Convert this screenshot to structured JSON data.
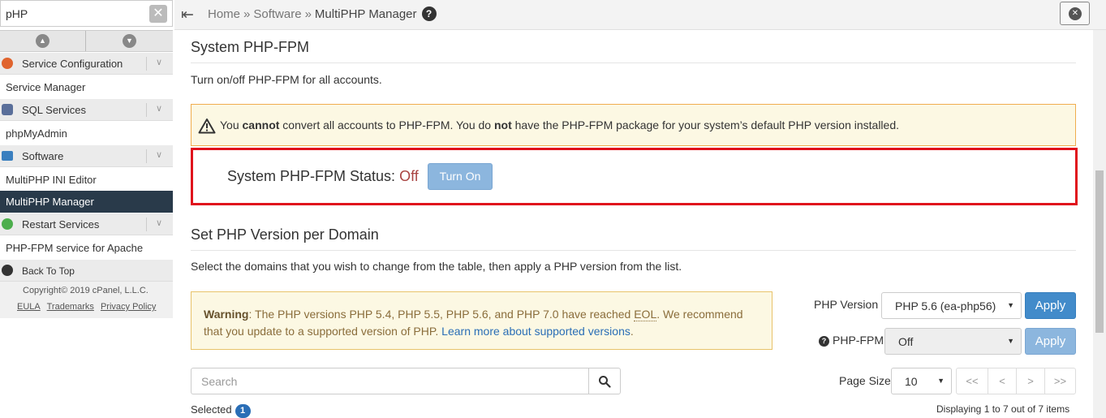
{
  "sidebar": {
    "search_value": "pHP",
    "groups": [
      {
        "label": "Service Configuration",
        "item": "Service Manager"
      },
      {
        "label": "SQL Services",
        "item": "phpMyAdmin"
      },
      {
        "label": "Software",
        "items": [
          "MultiPHP INI Editor",
          "MultiPHP Manager"
        ]
      },
      {
        "label": "Restart Services",
        "item": "PHP-FPM service for Apache"
      }
    ],
    "back_to_top": "Back To Top",
    "copyright": "Copyright© 2019 cPanel, L.L.C.",
    "footer_links": [
      "EULA",
      "Trademarks",
      "Privacy Policy"
    ]
  },
  "topbar": {
    "breadcrumb": [
      "Home",
      "Software",
      "MultiPHP Manager"
    ],
    "sep": "»"
  },
  "main": {
    "fpm_title": "System PHP-FPM",
    "fpm_desc": "Turn on/off PHP-FPM for all accounts.",
    "alert": {
      "p1": "You ",
      "b1": "cannot",
      "p2": " convert all accounts to PHP-FPM. You do ",
      "b2": "not",
      "p3": " have the PHP-FPM package for your system’s default PHP version installed."
    },
    "status_label": "System PHP-FPM Status:",
    "status_value": "Off",
    "turn_on_label": "Turn On",
    "domain_title": "Set PHP Version per Domain",
    "domain_desc": "Select the domains that you wish to change from the table, then apply a PHP version from the list.",
    "eol": {
      "b": "Warning",
      "p1": ": The PHP versions PHP 5.4, PHP 5.5, PHP 5.6, and PHP 7.0 have reached ",
      "abbr": "EOL",
      "p2": ". We recommend that you update to a supported version of PHP. ",
      "link": "Learn more about supported versions",
      "p3": "."
    },
    "php_version_label": "PHP Version",
    "php_version_value": "PHP 5.6 (ea-php56)",
    "php_fpm_label": "PHP-FPM",
    "php_fpm_value": "Off",
    "apply_label": "Apply",
    "search_placeholder": "Search",
    "page_size_label": "Page Size",
    "page_size_value": "10",
    "pager": [
      "<<",
      "<",
      ">",
      ">>"
    ],
    "selected_label": "Selected",
    "selected_count": "1",
    "displaying": "Displaying 1 to 7 out of 7 items"
  },
  "colors": {
    "active_nav": "#293a4a",
    "primary": "#428bca",
    "highlight_border": "#e0121c",
    "status_off": "#a94442"
  }
}
